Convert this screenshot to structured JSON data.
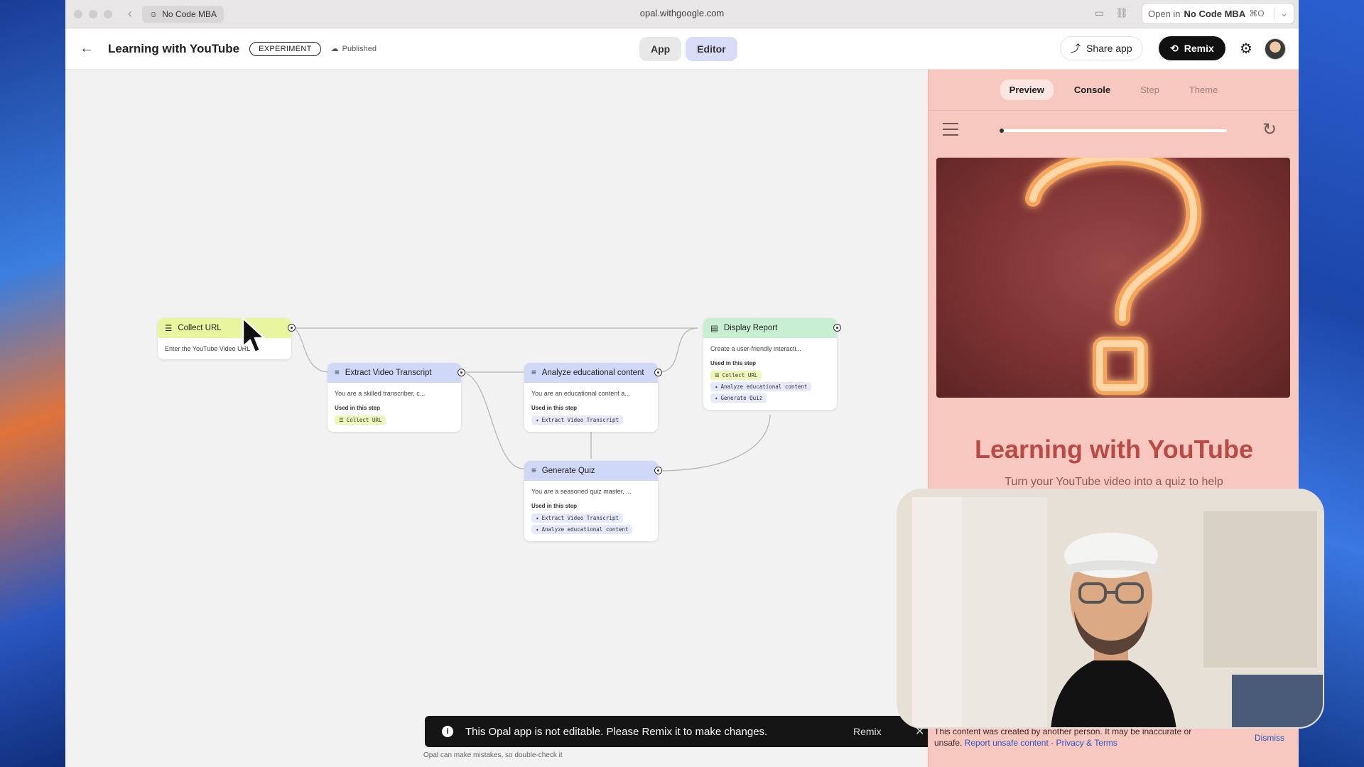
{
  "browser": {
    "tab_label": "No Code MBA",
    "url": "opal.withgoogle.com",
    "open_in_prefix": "Open in",
    "open_in_target": "No Code MBA",
    "open_in_shortcut": "⌘O"
  },
  "header": {
    "title": "Learning with YouTube",
    "badge": "EXPERIMENT",
    "status": "Published",
    "mode_app": "App",
    "mode_editor": "Editor",
    "active_mode": "Editor",
    "share_label": "Share app",
    "remix_label": "Remix"
  },
  "nodes": {
    "collect_url": {
      "title": "Collect URL",
      "desc": "Enter the YouTube Video URL"
    },
    "extract": {
      "title": "Extract Video Transcript",
      "desc": "You are a skilled transcriber, c...",
      "used_label": "Used in this step",
      "uses": [
        "Collect URL"
      ]
    },
    "analyze": {
      "title": "Analyze educational content",
      "desc": "You are an educational content a...",
      "used_label": "Used in this step",
      "uses": [
        "Extract Video Transcript"
      ]
    },
    "quiz": {
      "title": "Generate Quiz",
      "desc": "You are a seasoned quiz master, ...",
      "used_label": "Used in this step",
      "uses": [
        "Extract Video Transcript",
        "Analyze educational content"
      ]
    },
    "report": {
      "title": "Display Report",
      "desc": "Create a user-friendly interacti...",
      "used_label": "Used in this step",
      "uses": [
        "Collect URL",
        "Analyze educational content",
        "Generate Quiz"
      ]
    }
  },
  "toast": {
    "message": "This Opal app is not editable. Please Remix it to make changes.",
    "action": "Remix",
    "close": "✕"
  },
  "disclaimer": "Opal can make mistakes, so double-check it",
  "panel": {
    "tabs": [
      "Preview",
      "Console",
      "Step",
      "Theme"
    ],
    "active_tab": "Preview",
    "app_title": "Learning with YouTube",
    "app_subtitle": "Turn your YouTube video into a quiz to help",
    "footer_text": "This content was created by another person. It may be inaccurate or unsafe.",
    "report_link": "Report unsafe content",
    "privacy_link": "Privacy & Terms",
    "dismiss": "Dismiss"
  },
  "colors": {
    "input_node": "#eaf5a0",
    "generate_node": "#cfd8f6",
    "output_node": "#c9efd2",
    "preview_bg": "#f7c8c0",
    "accent_title": "#b94a46"
  }
}
